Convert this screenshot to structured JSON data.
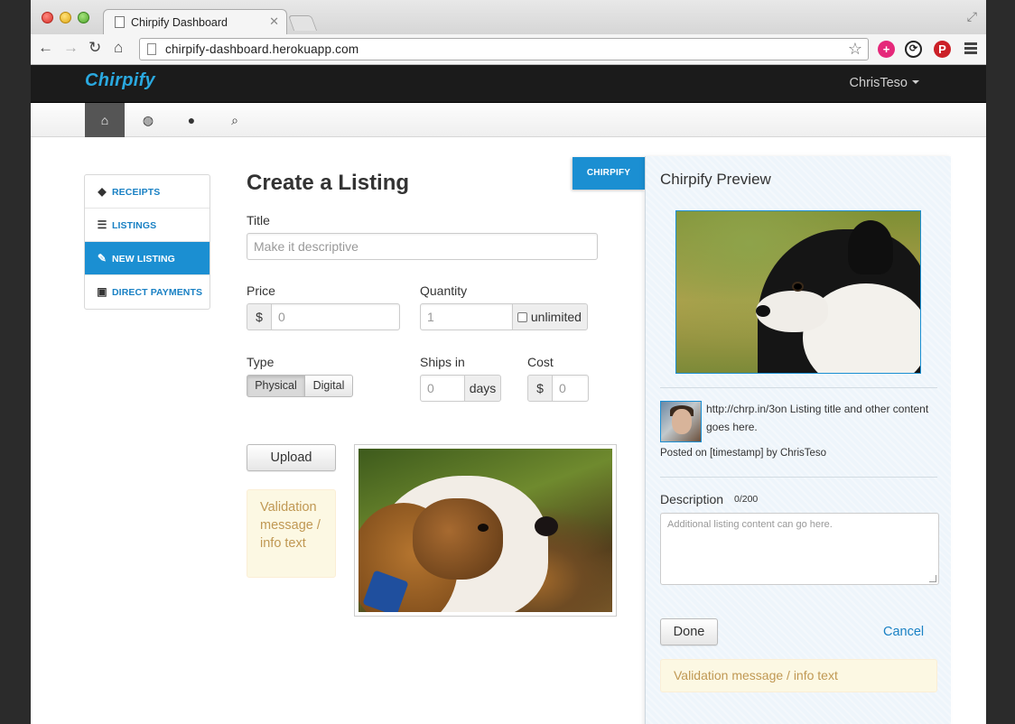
{
  "browser": {
    "tab_title": "Chirpify Dashboard",
    "url": "chirpify-dashboard.herokuapp.com"
  },
  "app": {
    "logo": "Chirpify",
    "user": "ChrisTeso"
  },
  "subnav": {
    "items": [
      {
        "icon": "home-icon",
        "active": true
      },
      {
        "icon": "globe-icon",
        "active": false
      },
      {
        "icon": "user-icon",
        "active": false
      },
      {
        "icon": "search-icon",
        "active": false
      }
    ]
  },
  "sidebar": {
    "items": [
      {
        "label": "RECEIPTS",
        "icon": "tag-icon"
      },
      {
        "label": "LISTINGS",
        "icon": "list-icon"
      },
      {
        "label": "NEW LISTING",
        "icon": "pencil-icon",
        "active": true
      },
      {
        "label": "DIRECT PAYMENTS",
        "icon": "gift-icon"
      }
    ]
  },
  "form": {
    "title": "Create a Listing",
    "title_label": "Title",
    "title_placeholder": "Make it descriptive",
    "price_label": "Price",
    "price_prefix": "$",
    "price_placeholder": "0",
    "quantity_label": "Quantity",
    "quantity_placeholder": "1",
    "unlimited_label": "unlimited",
    "type_label": "Type",
    "type_options": [
      "Physical",
      "Digital"
    ],
    "type_selected": "Physical",
    "ships_label": "Ships in",
    "ships_placeholder": "0",
    "ships_suffix": "days",
    "cost_label": "Cost",
    "cost_prefix": "$",
    "cost_placeholder": "0",
    "upload_label": "Upload",
    "validation": "Validation message / info text"
  },
  "preview": {
    "tab_label": "CHIRPIFY",
    "title": "Chirpify Preview",
    "text": "http://chrp.in/3on Listing title and other content goes here.",
    "posted": "Posted on [timestamp] by ChrisTeso",
    "description_label": "Description",
    "description_count": "0/200",
    "description_placeholder": "Additional listing content can go here.",
    "done_label": "Done",
    "cancel_label": "Cancel",
    "validation": "Validation message / info text"
  },
  "colors": {
    "accent": "#1b8fd2",
    "topbar": "#1b1b1b",
    "warning_bg": "#fcf8e3",
    "warning_text": "#c09853"
  }
}
